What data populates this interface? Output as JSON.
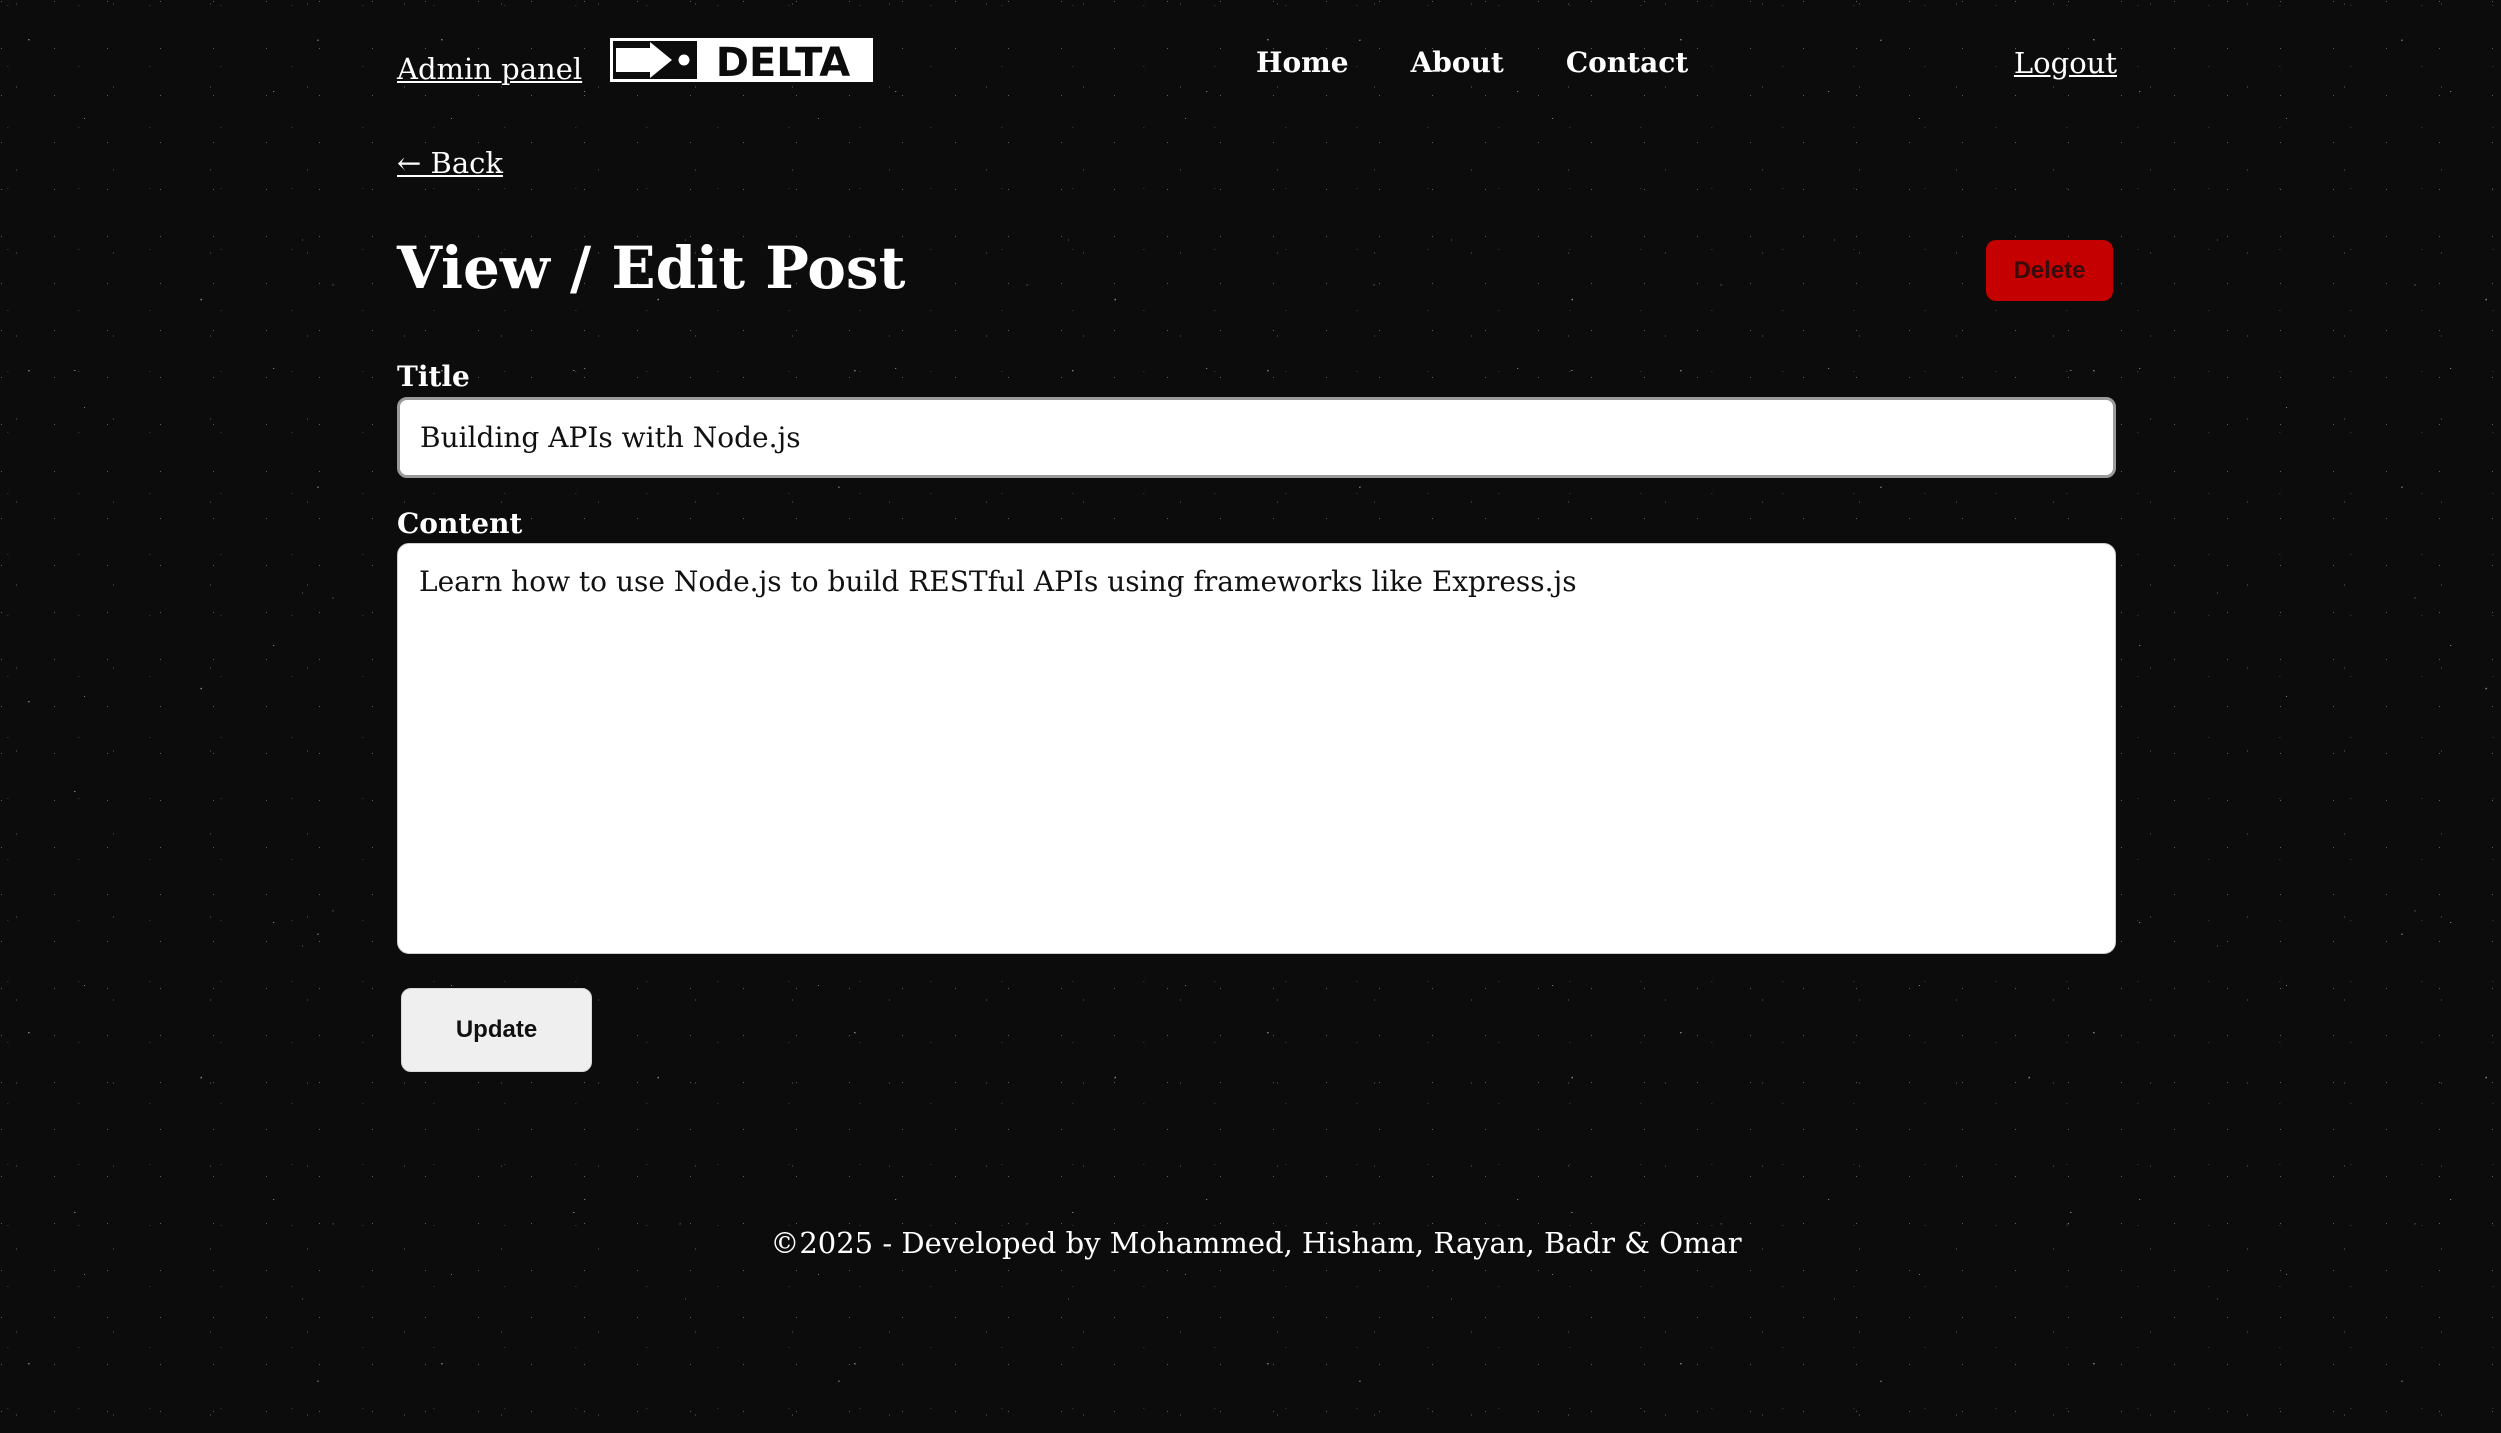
{
  "header": {
    "admin_link": "Admin panel ",
    "logo_text": "DELTA",
    "nav": [
      {
        "label": "Home"
      },
      {
        "label": "About"
      },
      {
        "label": "Contact"
      }
    ],
    "logout": "Logout"
  },
  "back_link": "← Back",
  "page_title": "View / Edit Post",
  "delete_label": "Delete",
  "form": {
    "title_label": "Title",
    "title_value": "Building APIs with Node.js",
    "content_label": "Content",
    "content_value": "Learn how to use Node.js to build RESTful APIs using frameworks like Express.js"
  },
  "update_label": "Update",
  "footer": "©2025 - Developed by Mohammed, Hisham, Rayan, Badr & Omar",
  "colors": {
    "background": "#0c0c0c",
    "delete_button": "#c40000",
    "update_button": "#efefef"
  }
}
